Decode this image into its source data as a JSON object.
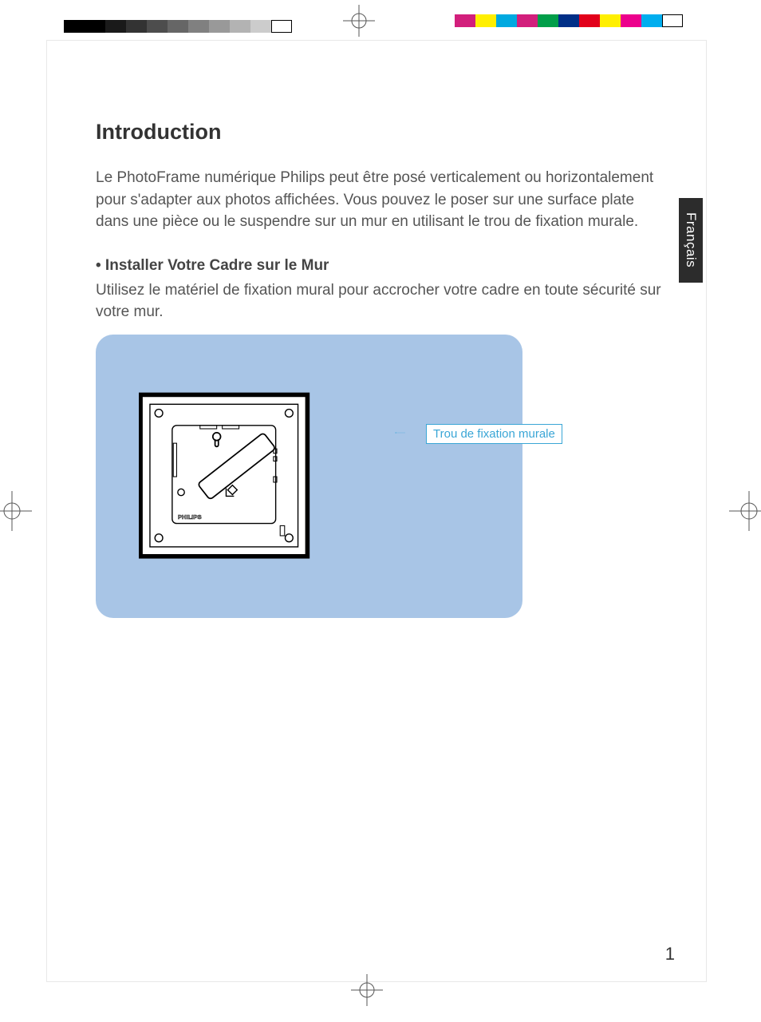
{
  "heading": "Introduction",
  "intro_paragraph": "Le PhotoFrame numérique Philips peut être posé verticalement ou horizontalement pour s'adapter aux photos affichées. Vous pouvez le poser sur une surface plate dans une pièce ou le suspendre sur un mur en utilisant le trou de fixation murale.",
  "subheading": "• Installer Votre Cadre sur le Mur",
  "subtext": "Utilisez le matériel de fixation mural pour accrocher votre cadre en toute sécurité sur votre mur.",
  "callout_label": "Trou de fixation murale",
  "brand_label": "PHILIPS",
  "language_tab": "Français",
  "page_number": "1",
  "bw_shades": [
    "#000000",
    "#000000",
    "#1a1a1a",
    "#333333",
    "#4d4d4d",
    "#666666",
    "#808080",
    "#999999",
    "#b3b3b3",
    "#cccccc",
    "#ffffff"
  ],
  "color_swatches": [
    "#d21f7c",
    "#ffef00",
    "#00a9e0",
    "#d21f7c",
    "#009e49",
    "#002f87",
    "#e2001a",
    "#ffef00",
    "#ec008c",
    "#00aeef",
    "#ffffff"
  ]
}
